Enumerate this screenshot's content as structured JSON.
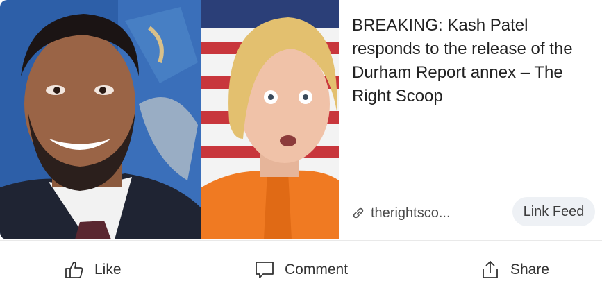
{
  "post": {
    "headline": "BREAKING: Kash Patel responds to the release of the Durham Report annex – The Right Scoop",
    "source_domain": "therightsco...",
    "feed_label": "Link Feed"
  },
  "actions": {
    "like": "Like",
    "comment": "Comment",
    "share": "Share"
  },
  "icons": {
    "link": "link-icon",
    "like": "thumbs-up-icon",
    "comment": "comment-bubble-icon",
    "share": "share-icon"
  },
  "colors": {
    "pill_bg": "#eef1f5",
    "text": "#222222"
  }
}
